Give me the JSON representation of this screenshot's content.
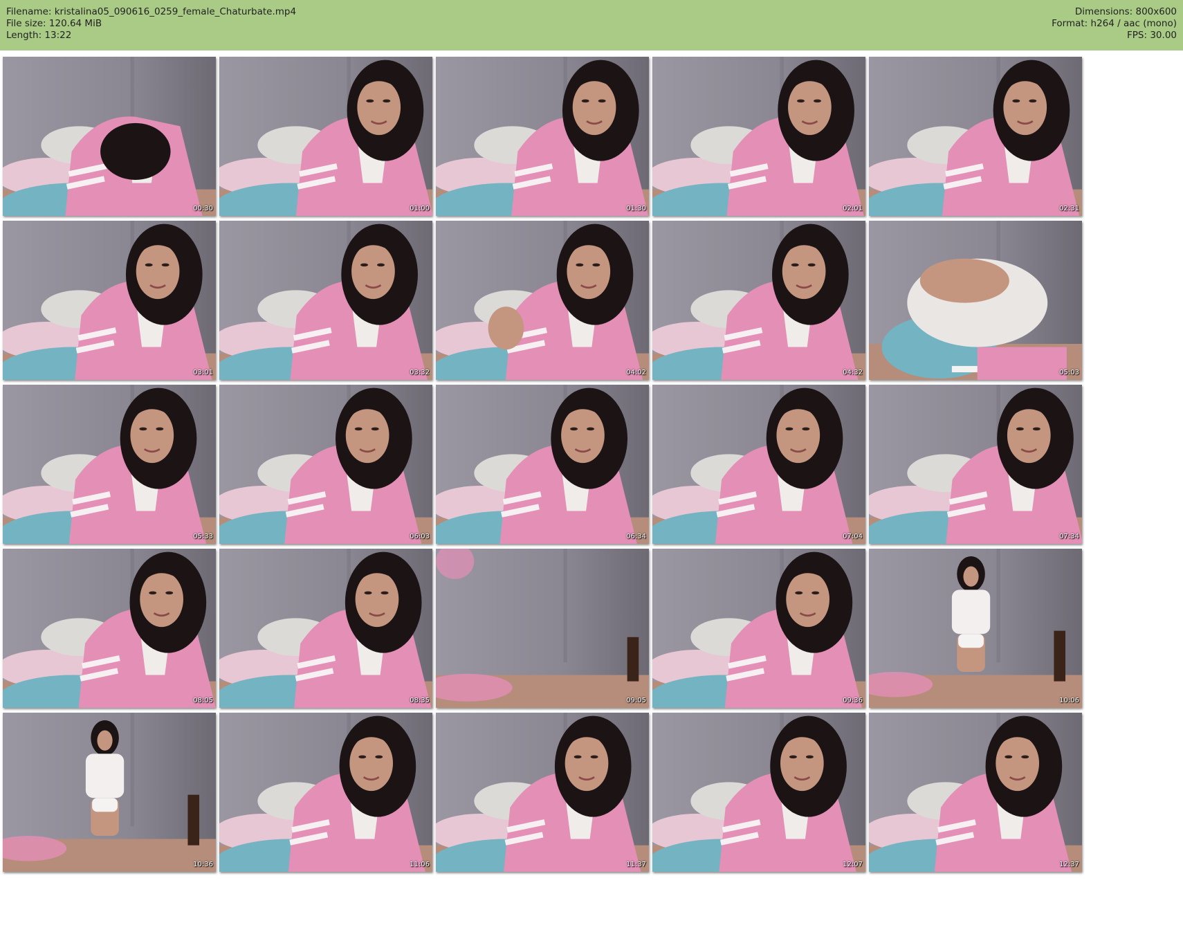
{
  "header": {
    "filename": "Filename: kristalina05_090616_0259_female_Chaturbate.mp4",
    "filesize": "File size: 120.64 MiB",
    "length": "Length: 13:22",
    "dimensions": "Dimensions: 800x600",
    "format": "Format: h264 / aac (mono)",
    "fps": "FPS: 30.00"
  },
  "colors": {
    "header_bg": "#aacb86",
    "wall": "#8f8c96",
    "hoodie": "#e48fb6",
    "pillow": "#74b3c2",
    "bedspread": "#b58d7a",
    "hair": "#1c1414",
    "skin": "#c49680"
  },
  "thumbnails": [
    {
      "time": "00:30",
      "scene": "closeup-down"
    },
    {
      "time": "01:00",
      "scene": "closeup"
    },
    {
      "time": "01:30",
      "scene": "closeup"
    },
    {
      "time": "02:01",
      "scene": "closeup"
    },
    {
      "time": "02:31",
      "scene": "closeup"
    },
    {
      "time": "03:01",
      "scene": "closeup"
    },
    {
      "time": "03:32",
      "scene": "closeup"
    },
    {
      "time": "04:02",
      "scene": "closeup-wave"
    },
    {
      "time": "04:32",
      "scene": "closeup"
    },
    {
      "time": "05:03",
      "scene": "back"
    },
    {
      "time": "05:33",
      "scene": "closeup"
    },
    {
      "time": "06:03",
      "scene": "closeup"
    },
    {
      "time": "06:34",
      "scene": "closeup"
    },
    {
      "time": "07:04",
      "scene": "closeup"
    },
    {
      "time": "07:34",
      "scene": "closeup"
    },
    {
      "time": "08:05",
      "scene": "closeup"
    },
    {
      "time": "08:35",
      "scene": "closeup"
    },
    {
      "time": "09:05",
      "scene": "empty-room"
    },
    {
      "time": "09:36",
      "scene": "closeup"
    },
    {
      "time": "10:06",
      "scene": "standing-far"
    },
    {
      "time": "10:36",
      "scene": "standing-far"
    },
    {
      "time": "11:06",
      "scene": "closeup"
    },
    {
      "time": "11:37",
      "scene": "closeup"
    },
    {
      "time": "12:07",
      "scene": "closeup"
    },
    {
      "time": "12:37",
      "scene": "closeup"
    }
  ]
}
